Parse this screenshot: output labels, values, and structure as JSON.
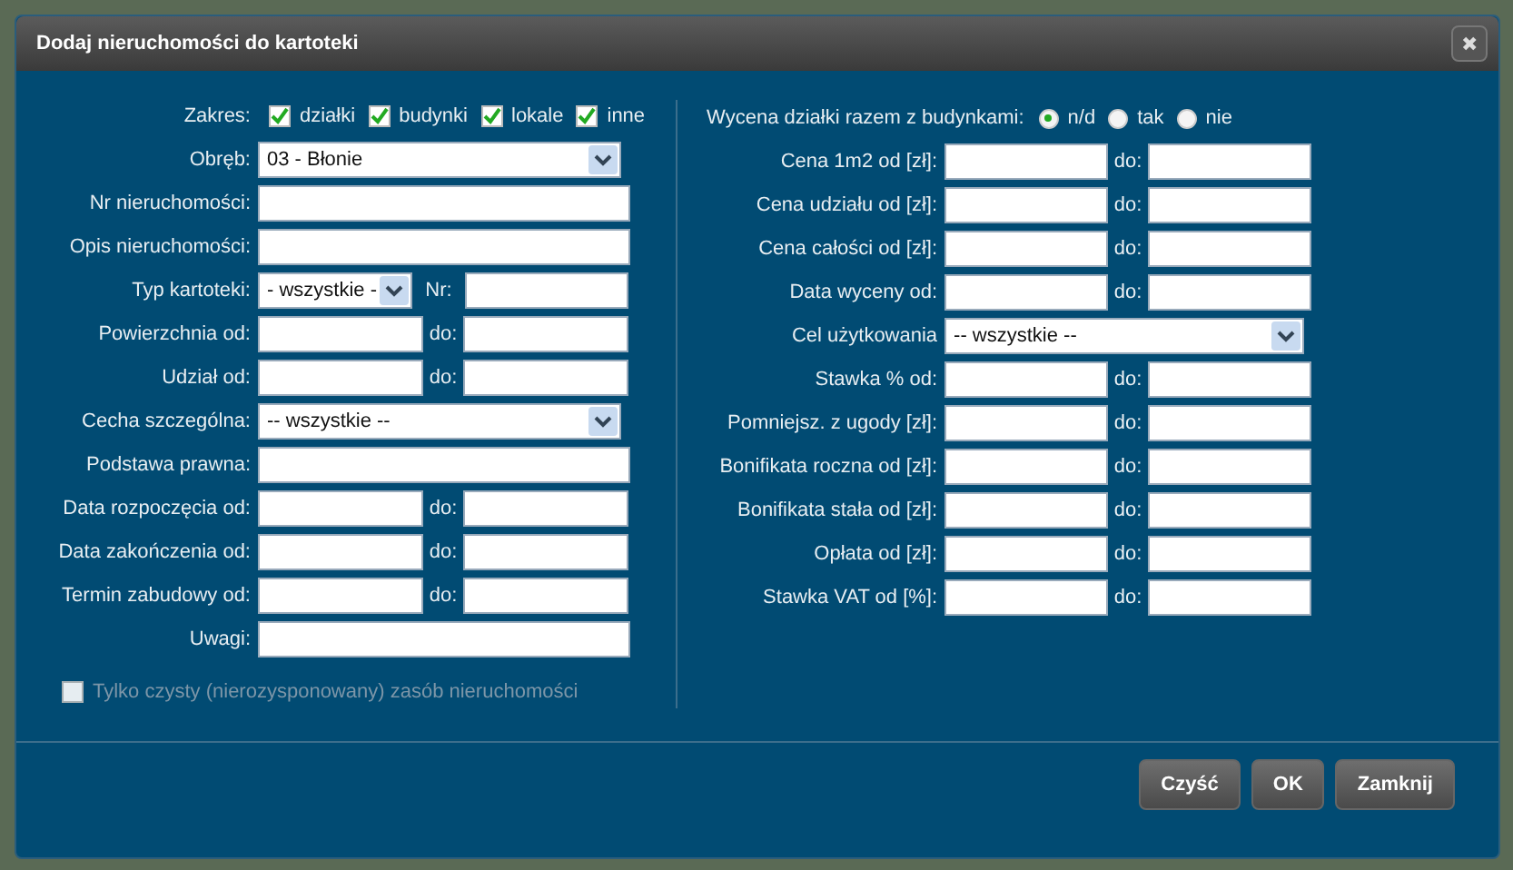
{
  "window": {
    "title": "Dodaj nieruchomości do kartoteki",
    "close": "✖"
  },
  "left": [
    {
      "kind": "checks",
      "label": "Zakres:",
      "options": [
        {
          "label": "działki",
          "checked": true
        },
        {
          "label": "budynki",
          "checked": true
        },
        {
          "label": "lokale",
          "checked": true
        },
        {
          "label": "inne",
          "checked": true
        }
      ]
    },
    {
      "kind": "select",
      "label": "Obręb:",
      "value": "03 - Błonie"
    },
    {
      "kind": "text",
      "label": "Nr nieruchomości:"
    },
    {
      "kind": "text",
      "label": "Opis nieruchomości:"
    },
    {
      "kind": "selectnr",
      "label": "Typ kartoteki:",
      "value": "- wszystkie -",
      "second": "Nr:"
    },
    {
      "kind": "range",
      "label": "Powierzchnia od:",
      "second": "do:"
    },
    {
      "kind": "range",
      "label": "Udział od:",
      "second": "do:"
    },
    {
      "kind": "select",
      "label": "Cecha szczególna:",
      "value": "-- wszystkie --"
    },
    {
      "kind": "text",
      "label": "Podstawa prawna:"
    },
    {
      "kind": "range",
      "label": "Data rozpoczęcia od:",
      "second": "do:"
    },
    {
      "kind": "range",
      "label": "Data zakończenia od:",
      "second": "do:"
    },
    {
      "kind": "range",
      "label": "Termin zabudowy od:",
      "second": "do:"
    },
    {
      "kind": "text",
      "label": "Uwagi:"
    },
    {
      "kind": "checkbox",
      "label": "Tylko czysty (nierozysponowany) zasób nieruchomości",
      "checked": false,
      "disabled": true
    }
  ],
  "right": [
    {
      "kind": "radios",
      "label": "Wycena działki razem z budynkami:",
      "options": [
        {
          "label": "n/d",
          "selected": true
        },
        {
          "label": "tak",
          "selected": false
        },
        {
          "label": "nie",
          "selected": false
        }
      ]
    },
    {
      "kind": "range",
      "label": "Cena 1m2 od [zł]:",
      "second": "do:"
    },
    {
      "kind": "range",
      "label": "Cena udziału od [zł]:",
      "second": "do:"
    },
    {
      "kind": "range",
      "label": "Cena całości od [zł]:",
      "second": "do:"
    },
    {
      "kind": "range",
      "label": "Data wyceny od:",
      "second": "do:"
    },
    {
      "kind": "select",
      "label": "Cel użytkowania",
      "value": "-- wszystkie --"
    },
    {
      "kind": "range",
      "label": "Stawka % od:",
      "second": "do:"
    },
    {
      "kind": "range",
      "label": "Pomniejsz. z ugody [zł]:",
      "second": "do:"
    },
    {
      "kind": "range",
      "label": "Bonifikata roczna od [zł]:",
      "second": "do:"
    },
    {
      "kind": "range",
      "label": "Bonifikata stała od [zł]:",
      "second": "do:"
    },
    {
      "kind": "range",
      "label": "Opłata od [zł]:",
      "second": "do:"
    },
    {
      "kind": "range",
      "label": "Stawka VAT od [%]:",
      "second": "do:"
    }
  ],
  "buttons": [
    "Czyść",
    "OK",
    "Zamknij"
  ]
}
